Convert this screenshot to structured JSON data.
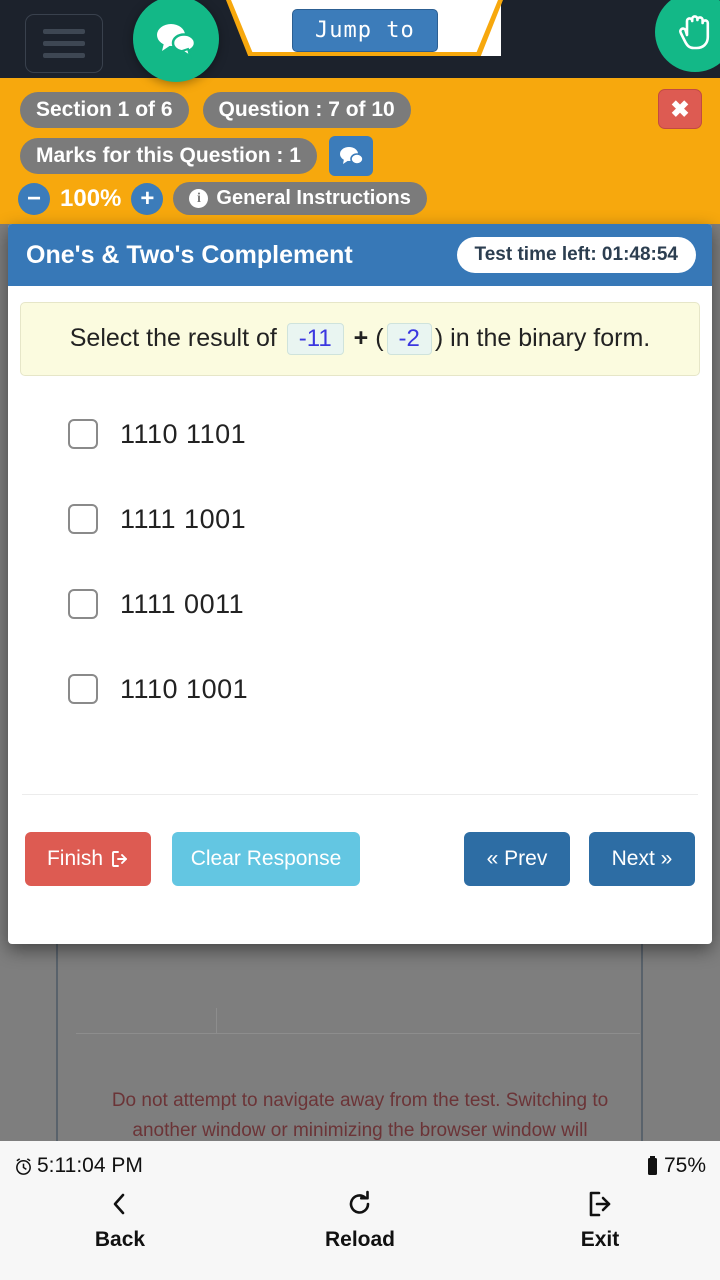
{
  "topbar": {
    "menu_icon": "hamburger-menu-icon",
    "chat_fab_icon": "chat-bubbles-icon",
    "jump_to_label": "Jump to",
    "hand_fab_icon": "raised-hand-icon"
  },
  "infobar": {
    "section": "Section 1 of 6",
    "question": "Question : 7 of 10",
    "marks": "Marks for this Question : 1",
    "chat_icon": "chat-bubble-icon",
    "zoom_out": "−",
    "zoom_level": "100%",
    "zoom_in": "+",
    "info_icon": "i",
    "general_instructions": "General Instructions",
    "close_icon": "✖",
    "accent_orange": "#F7A80D",
    "pill_gray": "#7B7B7B",
    "close_red": "#DD5B52"
  },
  "card": {
    "title": "One's & Two's Complement",
    "timer": "Test time left: 01:48:54",
    "header_blue": "#3778B7",
    "question": {
      "prefix": "Select the result of",
      "value1": "-11",
      "operator": "+",
      "open_paren": "(",
      "value2": "-2",
      "close_paren": ")",
      "suffix": "in the binary form."
    },
    "options": [
      {
        "label": "1110 1101",
        "checked": false
      },
      {
        "label": "1111 1001",
        "checked": false
      },
      {
        "label": "1111 0011",
        "checked": false
      },
      {
        "label": "1110 1001",
        "checked": false
      }
    ],
    "buttons": {
      "finish": "Finish",
      "finish_icon": "exit-arrow-icon",
      "clear": "Clear Response",
      "prev": "« Prev",
      "next": "Next »"
    }
  },
  "background": {
    "warning": "Do not attempt to navigate away from the test. Switching to another window or minimizing the browser window will automatically log you out of the test."
  },
  "bottomnav": {
    "clock_icon": "alarm-clock-icon",
    "time": "5:11:04 PM",
    "battery_icon": "battery-icon",
    "battery": "75%",
    "items": [
      {
        "label": "Back",
        "icon": "chevron-left-icon"
      },
      {
        "label": "Reload",
        "icon": "refresh-icon"
      },
      {
        "label": "Exit",
        "icon": "exit-icon"
      }
    ]
  }
}
